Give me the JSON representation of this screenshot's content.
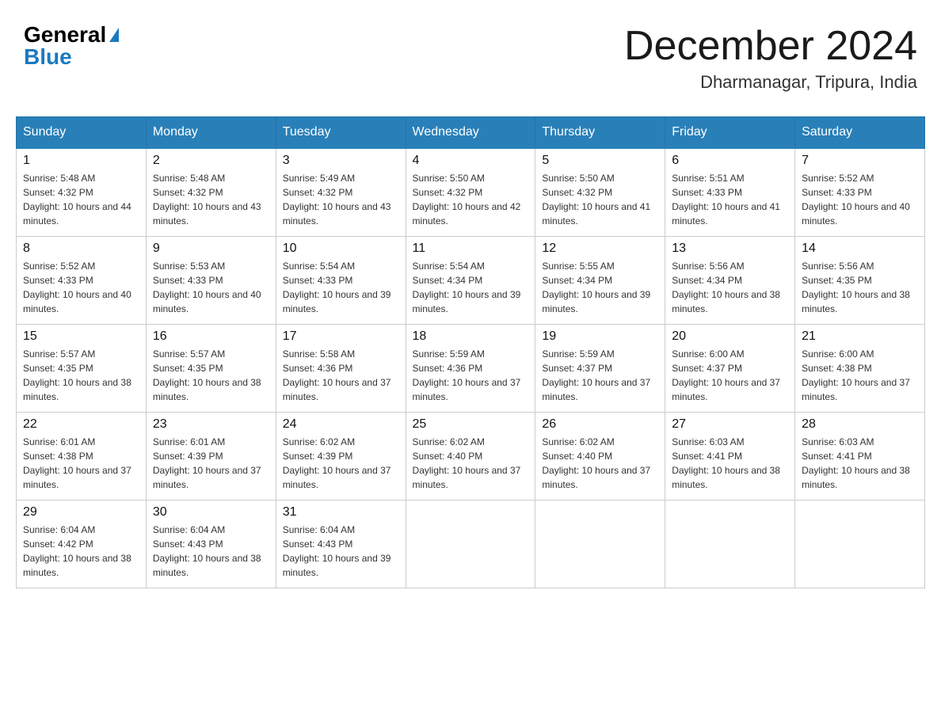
{
  "header": {
    "logo": {
      "general": "General",
      "blue": "Blue",
      "triangle": "▶"
    },
    "title": "December 2024",
    "subtitle": "Dharmanagar, Tripura, India"
  },
  "columns": [
    "Sunday",
    "Monday",
    "Tuesday",
    "Wednesday",
    "Thursday",
    "Friday",
    "Saturday"
  ],
  "weeks": [
    [
      {
        "day": "1",
        "sunrise": "Sunrise: 5:48 AM",
        "sunset": "Sunset: 4:32 PM",
        "daylight": "Daylight: 10 hours and 44 minutes."
      },
      {
        "day": "2",
        "sunrise": "Sunrise: 5:48 AM",
        "sunset": "Sunset: 4:32 PM",
        "daylight": "Daylight: 10 hours and 43 minutes."
      },
      {
        "day": "3",
        "sunrise": "Sunrise: 5:49 AM",
        "sunset": "Sunset: 4:32 PM",
        "daylight": "Daylight: 10 hours and 43 minutes."
      },
      {
        "day": "4",
        "sunrise": "Sunrise: 5:50 AM",
        "sunset": "Sunset: 4:32 PM",
        "daylight": "Daylight: 10 hours and 42 minutes."
      },
      {
        "day": "5",
        "sunrise": "Sunrise: 5:50 AM",
        "sunset": "Sunset: 4:32 PM",
        "daylight": "Daylight: 10 hours and 41 minutes."
      },
      {
        "day": "6",
        "sunrise": "Sunrise: 5:51 AM",
        "sunset": "Sunset: 4:33 PM",
        "daylight": "Daylight: 10 hours and 41 minutes."
      },
      {
        "day": "7",
        "sunrise": "Sunrise: 5:52 AM",
        "sunset": "Sunset: 4:33 PM",
        "daylight": "Daylight: 10 hours and 40 minutes."
      }
    ],
    [
      {
        "day": "8",
        "sunrise": "Sunrise: 5:52 AM",
        "sunset": "Sunset: 4:33 PM",
        "daylight": "Daylight: 10 hours and 40 minutes."
      },
      {
        "day": "9",
        "sunrise": "Sunrise: 5:53 AM",
        "sunset": "Sunset: 4:33 PM",
        "daylight": "Daylight: 10 hours and 40 minutes."
      },
      {
        "day": "10",
        "sunrise": "Sunrise: 5:54 AM",
        "sunset": "Sunset: 4:33 PM",
        "daylight": "Daylight: 10 hours and 39 minutes."
      },
      {
        "day": "11",
        "sunrise": "Sunrise: 5:54 AM",
        "sunset": "Sunset: 4:34 PM",
        "daylight": "Daylight: 10 hours and 39 minutes."
      },
      {
        "day": "12",
        "sunrise": "Sunrise: 5:55 AM",
        "sunset": "Sunset: 4:34 PM",
        "daylight": "Daylight: 10 hours and 39 minutes."
      },
      {
        "day": "13",
        "sunrise": "Sunrise: 5:56 AM",
        "sunset": "Sunset: 4:34 PM",
        "daylight": "Daylight: 10 hours and 38 minutes."
      },
      {
        "day": "14",
        "sunrise": "Sunrise: 5:56 AM",
        "sunset": "Sunset: 4:35 PM",
        "daylight": "Daylight: 10 hours and 38 minutes."
      }
    ],
    [
      {
        "day": "15",
        "sunrise": "Sunrise: 5:57 AM",
        "sunset": "Sunset: 4:35 PM",
        "daylight": "Daylight: 10 hours and 38 minutes."
      },
      {
        "day": "16",
        "sunrise": "Sunrise: 5:57 AM",
        "sunset": "Sunset: 4:35 PM",
        "daylight": "Daylight: 10 hours and 38 minutes."
      },
      {
        "day": "17",
        "sunrise": "Sunrise: 5:58 AM",
        "sunset": "Sunset: 4:36 PM",
        "daylight": "Daylight: 10 hours and 37 minutes."
      },
      {
        "day": "18",
        "sunrise": "Sunrise: 5:59 AM",
        "sunset": "Sunset: 4:36 PM",
        "daylight": "Daylight: 10 hours and 37 minutes."
      },
      {
        "day": "19",
        "sunrise": "Sunrise: 5:59 AM",
        "sunset": "Sunset: 4:37 PM",
        "daylight": "Daylight: 10 hours and 37 minutes."
      },
      {
        "day": "20",
        "sunrise": "Sunrise: 6:00 AM",
        "sunset": "Sunset: 4:37 PM",
        "daylight": "Daylight: 10 hours and 37 minutes."
      },
      {
        "day": "21",
        "sunrise": "Sunrise: 6:00 AM",
        "sunset": "Sunset: 4:38 PM",
        "daylight": "Daylight: 10 hours and 37 minutes."
      }
    ],
    [
      {
        "day": "22",
        "sunrise": "Sunrise: 6:01 AM",
        "sunset": "Sunset: 4:38 PM",
        "daylight": "Daylight: 10 hours and 37 minutes."
      },
      {
        "day": "23",
        "sunrise": "Sunrise: 6:01 AM",
        "sunset": "Sunset: 4:39 PM",
        "daylight": "Daylight: 10 hours and 37 minutes."
      },
      {
        "day": "24",
        "sunrise": "Sunrise: 6:02 AM",
        "sunset": "Sunset: 4:39 PM",
        "daylight": "Daylight: 10 hours and 37 minutes."
      },
      {
        "day": "25",
        "sunrise": "Sunrise: 6:02 AM",
        "sunset": "Sunset: 4:40 PM",
        "daylight": "Daylight: 10 hours and 37 minutes."
      },
      {
        "day": "26",
        "sunrise": "Sunrise: 6:02 AM",
        "sunset": "Sunset: 4:40 PM",
        "daylight": "Daylight: 10 hours and 37 minutes."
      },
      {
        "day": "27",
        "sunrise": "Sunrise: 6:03 AM",
        "sunset": "Sunset: 4:41 PM",
        "daylight": "Daylight: 10 hours and 38 minutes."
      },
      {
        "day": "28",
        "sunrise": "Sunrise: 6:03 AM",
        "sunset": "Sunset: 4:41 PM",
        "daylight": "Daylight: 10 hours and 38 minutes."
      }
    ],
    [
      {
        "day": "29",
        "sunrise": "Sunrise: 6:04 AM",
        "sunset": "Sunset: 4:42 PM",
        "daylight": "Daylight: 10 hours and 38 minutes."
      },
      {
        "day": "30",
        "sunrise": "Sunrise: 6:04 AM",
        "sunset": "Sunset: 4:43 PM",
        "daylight": "Daylight: 10 hours and 38 minutes."
      },
      {
        "day": "31",
        "sunrise": "Sunrise: 6:04 AM",
        "sunset": "Sunset: 4:43 PM",
        "daylight": "Daylight: 10 hours and 39 minutes."
      },
      {
        "day": "",
        "sunrise": "",
        "sunset": "",
        "daylight": ""
      },
      {
        "day": "",
        "sunrise": "",
        "sunset": "",
        "daylight": ""
      },
      {
        "day": "",
        "sunrise": "",
        "sunset": "",
        "daylight": ""
      },
      {
        "day": "",
        "sunrise": "",
        "sunset": "",
        "daylight": ""
      }
    ]
  ]
}
